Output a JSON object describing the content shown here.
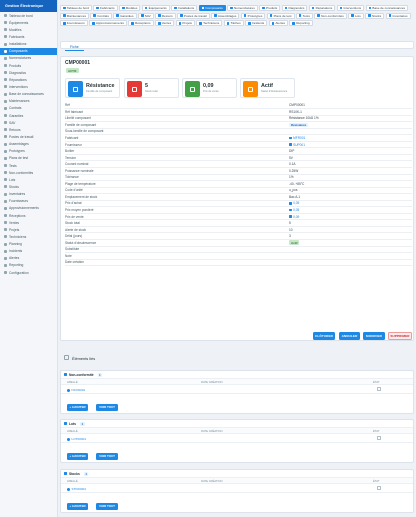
{
  "sidebar": {
    "brand": "Gestion Électronique",
    "items": [
      {
        "label": "Tableau de bord",
        "active": false
      },
      {
        "label": "Équipements",
        "active": false
      },
      {
        "label": "Modèles",
        "active": false
      },
      {
        "label": "Fabricants",
        "active": false
      },
      {
        "label": "Installations",
        "active": false
      },
      {
        "label": "Composants",
        "active": true
      },
      {
        "label": "Nomenclatures",
        "active": false
      },
      {
        "label": "Produits",
        "active": false
      },
      {
        "label": "Diagnostics",
        "active": false
      },
      {
        "label": "Réparations",
        "active": false
      },
      {
        "label": "Interventions",
        "active": false
      },
      {
        "label": "Base de connaissances",
        "active": false
      },
      {
        "label": "Maintenances",
        "active": false
      },
      {
        "label": "Contrats",
        "active": false
      },
      {
        "label": "Garanties",
        "active": false
      },
      {
        "label": "SAV",
        "active": false
      },
      {
        "label": "Retours",
        "active": false
      },
      {
        "label": "Postes de travail",
        "active": false
      },
      {
        "label": "Assemblages",
        "active": false
      },
      {
        "label": "Prototypes",
        "active": false
      },
      {
        "label": "Plans de test",
        "active": false
      },
      {
        "label": "Tests",
        "active": false
      },
      {
        "label": "Non-conformités",
        "active": false
      },
      {
        "label": "Lots",
        "active": false
      },
      {
        "label": "Stocks",
        "active": false
      },
      {
        "label": "Inventaires",
        "active": false
      },
      {
        "label": "Fournisseurs",
        "active": false
      },
      {
        "label": "Approvisionnements",
        "active": false
      },
      {
        "label": "Réceptions",
        "active": false
      },
      {
        "label": "Ventes",
        "active": false
      },
      {
        "label": "Projets",
        "active": false
      },
      {
        "label": "Techniciens",
        "active": false
      },
      {
        "label": "Planning",
        "active": false
      },
      {
        "label": "Incidents",
        "active": false
      },
      {
        "label": "Alertes",
        "active": false
      },
      {
        "label": "Reporting",
        "active": false
      },
      {
        "label": "Configuration",
        "active": false
      }
    ]
  },
  "topnav": [
    {
      "label": "Tableau de bord",
      "active": false
    },
    {
      "label": "Fabricants",
      "active": false
    },
    {
      "label": "Modèles",
      "active": false
    },
    {
      "label": "Équipements",
      "active": false
    },
    {
      "label": "Installations",
      "active": false
    },
    {
      "label": "Composants",
      "active": true
    },
    {
      "label": "Nomenclatures",
      "active": false
    },
    {
      "label": "Produits",
      "active": false
    },
    {
      "label": "Diagnostics",
      "active": false
    },
    {
      "label": "Réparations",
      "active": false
    },
    {
      "label": "Interventions",
      "active": false
    },
    {
      "label": "Base de connaissances",
      "active": false
    },
    {
      "label": "Maintenances",
      "active": false
    },
    {
      "label": "Contrats",
      "active": false
    },
    {
      "label": "Garanties",
      "active": false
    },
    {
      "label": "SAV",
      "active": false
    },
    {
      "label": "Retours",
      "active": false
    },
    {
      "label": "Postes de travail",
      "active": false
    },
    {
      "label": "Assemblages",
      "active": false
    },
    {
      "label": "Prototypes",
      "active": false
    },
    {
      "label": "Plans de test",
      "active": false
    },
    {
      "label": "Tests",
      "active": false
    },
    {
      "label": "Non-conformités",
      "active": false
    },
    {
      "label": "Lots",
      "active": false
    },
    {
      "label": "Stocks",
      "active": false
    },
    {
      "label": "Inventaires",
      "active": false
    },
    {
      "label": "Fournisseurs",
      "active": false
    },
    {
      "label": "Approvisionnements",
      "active": false
    },
    {
      "label": "Réceptions",
      "active": false
    },
    {
      "label": "Ventes",
      "active": false
    },
    {
      "label": "Projets",
      "active": false
    },
    {
      "label": "Techniciens",
      "active": false
    },
    {
      "label": "Tâches",
      "active": false
    },
    {
      "label": "Incidents",
      "active": false
    },
    {
      "label": "Alertes",
      "active": false
    },
    {
      "label": "Reporting",
      "active": false
    }
  ],
  "detail": {
    "tab": "Fiche",
    "title": "CMP00001",
    "status_badge": "ACTIF",
    "stats": [
      {
        "value": "Résistance",
        "label": "Famille de composant",
        "color": "#1e88e5"
      },
      {
        "value": "5",
        "label": "Stock total",
        "color": "#e53935"
      },
      {
        "value": "0,09",
        "label": "Prix de vente",
        "color": "#43a047"
      },
      {
        "value": "Actif",
        "label": "Statut d'obsolescence",
        "color": "#fb8c00"
      }
    ],
    "properties": [
      {
        "key": "Réf",
        "value": "CMP00001",
        "type": "text"
      },
      {
        "key": "Réf fabricant",
        "value": "RS10K-1",
        "type": "text"
      },
      {
        "key": "Libellé composant",
        "value": "Résistance 10kΩ 1%",
        "type": "text"
      },
      {
        "key": "Famille de composant",
        "value": "Résistance",
        "type": "pill"
      },
      {
        "key": "Sous-famille de composant",
        "value": "",
        "type": "text"
      },
      {
        "key": "Fabricant",
        "value": "MFR001",
        "type": "link"
      },
      {
        "key": "Fournisseur",
        "value": "SUP001",
        "type": "link"
      },
      {
        "key": "Boîtier",
        "value": "DIP",
        "type": "text"
      },
      {
        "key": "Tension",
        "value": "5V",
        "type": "text"
      },
      {
        "key": "Courant nominal",
        "value": "0.1A",
        "type": "text"
      },
      {
        "key": "Puissance nominale",
        "value": "0.25W",
        "type": "text"
      },
      {
        "key": "Tolérance",
        "value": "1%",
        "type": "text"
      },
      {
        "key": "Plage de température",
        "value": "-40..+85°C",
        "type": "text"
      },
      {
        "key": "Code d'unité",
        "value": "u_pcs",
        "type": "text"
      },
      {
        "key": "Emplacement de stock",
        "value": "Bac A-1",
        "type": "text"
      },
      {
        "key": "Prix d'achat",
        "value": "0,05",
        "type": "link"
      },
      {
        "key": "Prix moyen pondéré",
        "value": "0,05",
        "type": "link"
      },
      {
        "key": "Prix de vente",
        "value": "0,09",
        "type": "link"
      },
      {
        "key": "Stock total",
        "value": "5",
        "type": "text"
      },
      {
        "key": "Alerte de stock",
        "value": "10",
        "type": "text"
      },
      {
        "key": "Délai (jours)",
        "value": "3",
        "type": "text"
      },
      {
        "key": "Statut d'obsolescence",
        "value": "Actif",
        "type": "pill-green"
      },
      {
        "key": "Substitute",
        "value": "",
        "type": "text"
      },
      {
        "key": "Note",
        "value": "",
        "type": "text"
      },
      {
        "key": "Date création",
        "value": "",
        "type": "text"
      }
    ],
    "actions": {
      "close": "CLÔTURER",
      "cancel": "ANNULER",
      "edit": "MODIFIER",
      "delete": "SUPPRIMER"
    }
  },
  "related": {
    "title": "Éléments liés",
    "sections": [
      {
        "name": "Non-conformité",
        "count": "1",
        "col_label": "LIBELLÉ",
        "col_date": "DATE CRÉATION",
        "col_status": "ÉTAT",
        "rows": [
          "NCO0001"
        ],
        "add": "+ AJOUTER",
        "view": "VOIR TOUT"
      },
      {
        "name": "Lots",
        "count": "1",
        "col_label": "LIBELLÉ",
        "col_date": "DATE CRÉATION",
        "col_status": "ÉTAT",
        "rows": [
          "LOT00001"
        ],
        "add": "+ AJOUTER",
        "view": "VOIR TOUT"
      },
      {
        "name": "Stocks",
        "count": "1",
        "col_label": "LIBELLÉ",
        "col_date": "DATE CRÉATION",
        "col_status": "ÉTAT",
        "rows": [
          "STK00001"
        ],
        "add": "+ AJOUTER",
        "view": "VOIR TOUT"
      }
    ]
  }
}
